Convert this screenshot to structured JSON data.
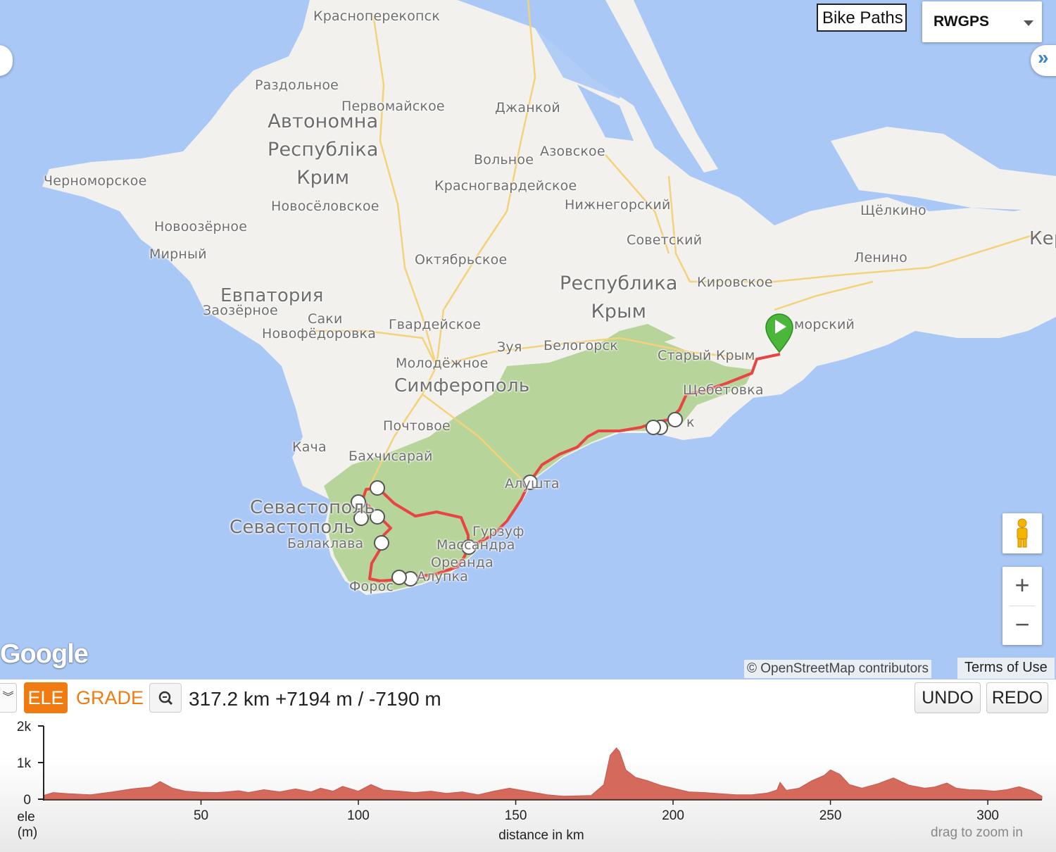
{
  "map": {
    "labels": {
      "krasnoperekopsk": "Красноперекопск",
      "razdolnoe": "Раздольное",
      "pervomayskoe": "Первомайское",
      "dzhankoy": "Джанкой",
      "volnoe": "Вольное",
      "azovskoe": "Азовское",
      "krasnogvardeyskoe": "Красногвардейское",
      "nizhnegorsky": "Нижнегорский",
      "chernomorskoe": "Черноморское",
      "novoselovskoe": "Новосёловское",
      "novoozernoe": "Новоозёрное",
      "mirny": "Мирный",
      "oktyabrskoe": "Октябрьское",
      "sovetsky": "Советский",
      "shchelkino": "Щёлкино",
      "lenino": "Ленино",
      "ker": "Кер",
      "kirovskoe": "Кировское",
      "evpatoriya": "Евпатория",
      "zaozernoe": "Заозёрное",
      "saki": "Саки",
      "novofedorovka": "Новофёдоровка",
      "gvardeyskoe": "Гвардейское",
      "zuya": "Зуя",
      "belogorsk": "Белогорск",
      "stary_krym": "Старый Крым",
      "primorsky": "морский",
      "molodezhnoe": "Молодёжное",
      "simferopol": "Симферополь",
      "shchebetovka": "Щебетовка",
      "sudak": "к",
      "pochtovoe": "Почтовое",
      "kacha": "Кача",
      "bakhchisaray": "Бахчисарай",
      "alushta": "Алушта",
      "sevastopol1": "Севастополь",
      "sevastopol2": "Севастополь",
      "balaklava": "Балаклава",
      "gurzuf": "Гурзуф",
      "massandra": "Массандра",
      "oreanda": "Ореанда",
      "alupka": "Алупка",
      "foros": "Форос"
    },
    "region_ukr": [
      "Автономна",
      "Республіка",
      "Крим"
    ],
    "region_rus": [
      "Республика",
      "Крым"
    ],
    "bike_paths_label": "Bike Paths",
    "basemap_select": "RWGPS",
    "google_logo": "Google",
    "osm_credit": "© OpenStreetMap contributors",
    "terms": "Terms of Use",
    "zoom_in": "+",
    "zoom_out": "−",
    "colors": {
      "water": "#aac8f5",
      "land": "#f2f1ed",
      "forest": "#b7d49a",
      "route": "#e84444",
      "marker": "#4ab63a"
    }
  },
  "panel": {
    "collapse_icon": "»",
    "tab_ele": "ELE",
    "tab_grade": "GRADE",
    "stats": "317.2 km +7194 m / -7190 m",
    "undo": "UNDO",
    "redo": "REDO",
    "hint": "drag to zoom in",
    "colors": {
      "accent": "#f07b11",
      "fill": "#d4695c"
    }
  },
  "chart_data": {
    "type": "area",
    "title": "",
    "xlabel": "distance in km",
    "ylabel": "ele (m)",
    "ylabel_lines": [
      "ele",
      "(m)"
    ],
    "xlim": [
      0,
      317.2
    ],
    "ylim": [
      0,
      2000
    ],
    "x_ticks": [
      50,
      100,
      150,
      200,
      250,
      300
    ],
    "x_tick_labels": [
      "50",
      "100",
      "150",
      "200",
      "250",
      "300"
    ],
    "y_ticks": [
      0,
      1000,
      2000
    ],
    "y_tick_labels": [
      "0",
      "1k",
      "2k"
    ],
    "series": [
      {
        "x": [
          0,
          3,
          8,
          15,
          22,
          28,
          34,
          37,
          41,
          45,
          50,
          55,
          58,
          62,
          65,
          70,
          75,
          80,
          85,
          88,
          92,
          95,
          100,
          104,
          108,
          113,
          118,
          123,
          128,
          133,
          138,
          143,
          148,
          152,
          156,
          160,
          165,
          170,
          174,
          178,
          180,
          182,
          183,
          185,
          188,
          192,
          196,
          200,
          205,
          210,
          215,
          220,
          225,
          230,
          233,
          234,
          236,
          240,
          244,
          248,
          250,
          253,
          256,
          260,
          265,
          270,
          275,
          280,
          283,
          287,
          290,
          294,
          298,
          302,
          306,
          310,
          314,
          317.2
        ],
        "y": [
          100,
          180,
          150,
          120,
          200,
          280,
          330,
          480,
          300,
          220,
          190,
          180,
          200,
          230,
          180,
          260,
          200,
          280,
          200,
          300,
          220,
          350,
          220,
          400,
          250,
          220,
          180,
          220,
          160,
          200,
          120,
          220,
          300,
          240,
          180,
          120,
          80,
          90,
          100,
          400,
          1200,
          1400,
          1300,
          800,
          600,
          500,
          380,
          300,
          200,
          180,
          150,
          120,
          120,
          170,
          250,
          460,
          240,
          300,
          500,
          650,
          800,
          680,
          400,
          300,
          420,
          580,
          380,
          300,
          330,
          440,
          300,
          260,
          250,
          220,
          260,
          340,
          230,
          80
        ]
      }
    ]
  }
}
